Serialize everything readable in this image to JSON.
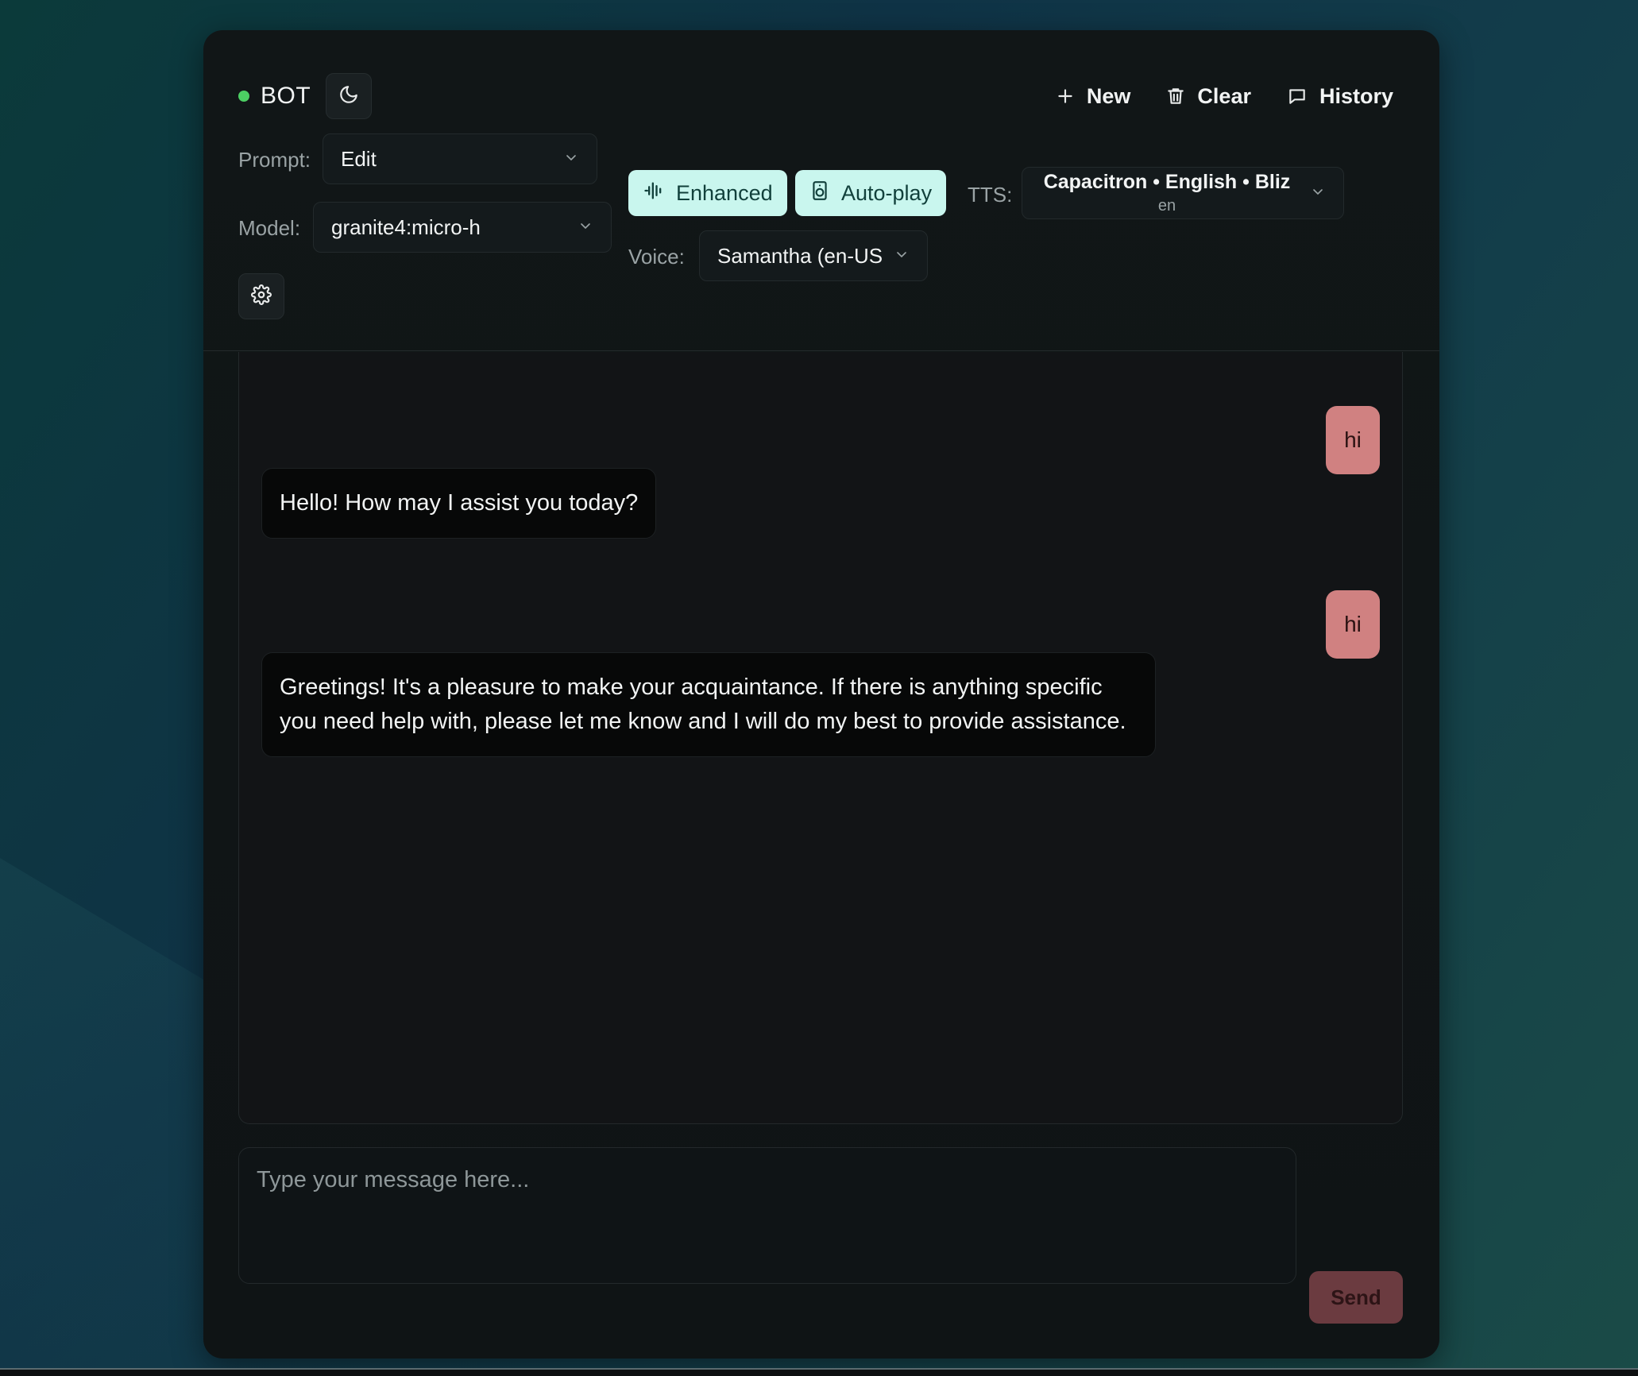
{
  "brand": {
    "name": "BOT",
    "status_color": "#4ccf63"
  },
  "header": {
    "actions": [
      {
        "label": "New",
        "icon": "plus-icon"
      },
      {
        "label": "Clear",
        "icon": "trash-icon"
      },
      {
        "label": "History",
        "icon": "chat-bubble-icon"
      }
    ]
  },
  "controls": {
    "prompt_label": "Prompt:",
    "prompt_value": "Edit",
    "model_label": "Model:",
    "model_value": "granite4:micro-h",
    "enhanced_label": "Enhanced",
    "autoplay_label": "Auto-play",
    "tts_label": "TTS:",
    "tts_value": "Capacitron • English • Bliz",
    "tts_sub": "en",
    "voice_label": "Voice:",
    "voice_value": "Samantha (en-US"
  },
  "messages": [
    {
      "role": "user",
      "text": "hi"
    },
    {
      "role": "bot",
      "text": "Hello! How may I assist you today?"
    },
    {
      "role": "user",
      "text": "hi"
    },
    {
      "role": "bot",
      "text": "Greetings! It's a pleasure to make your acquaintance. If there is anything specific you need help with, please let me know and I will do my best to provide assistance."
    }
  ],
  "composer": {
    "placeholder": "Type your message here...",
    "send_label": "Send"
  },
  "colors": {
    "accent_pill": "#c9f6ee",
    "user_bubble": "#d08181",
    "send_button": "#6b3b40"
  }
}
